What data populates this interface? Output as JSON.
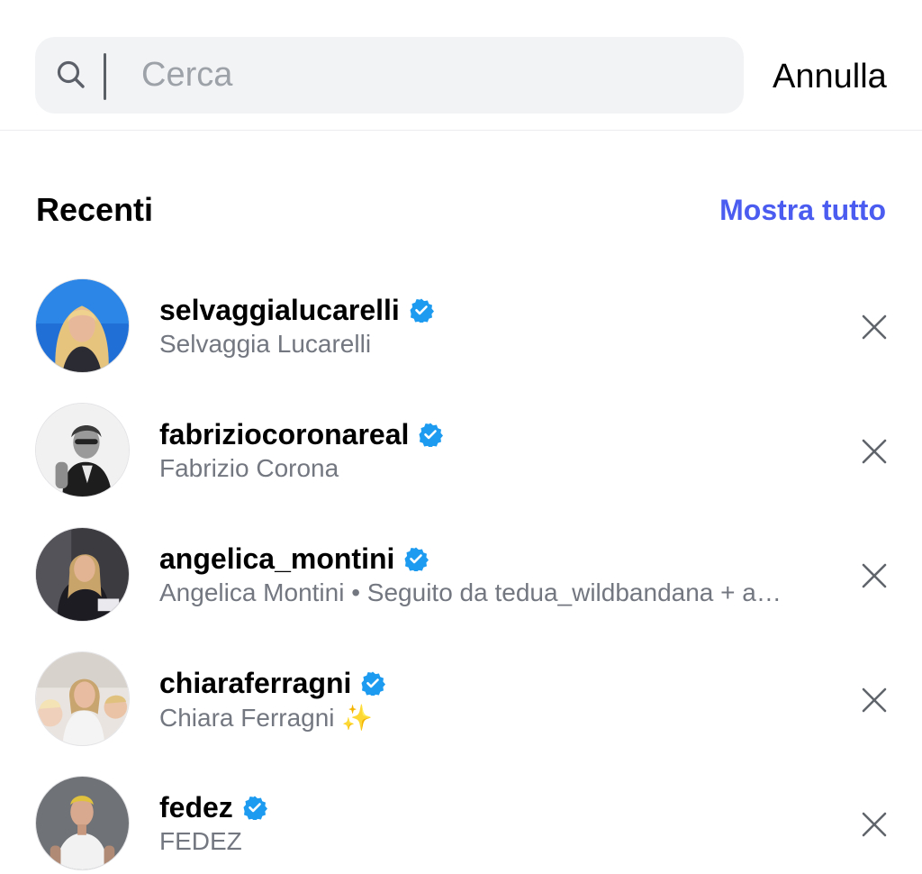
{
  "search": {
    "placeholder": "Cerca",
    "value": "",
    "cancel_label": "Annulla"
  },
  "recent": {
    "title": "Recenti",
    "show_all_label": "Mostra tutto",
    "items": [
      {
        "username": "selvaggialucarelli",
        "subtitle": "Selvaggia Lucarelli",
        "verified": true
      },
      {
        "username": "fabriziocoronareal",
        "subtitle": "Fabrizio Corona",
        "verified": true
      },
      {
        "username": "angelica_montini",
        "subtitle": "Angelica Montini • Seguito da tedua_wildbandana + a…",
        "verified": true
      },
      {
        "username": "chiaraferragni",
        "subtitle": "Chiara Ferragni ✨",
        "verified": true
      },
      {
        "username": "fedez",
        "subtitle": "FEDEZ",
        "verified": true
      }
    ]
  },
  "colors": {
    "link": "#4a5df0",
    "verified": "#1d9bf0",
    "secondary_text": "#737780",
    "search_bg": "#f2f3f5"
  }
}
